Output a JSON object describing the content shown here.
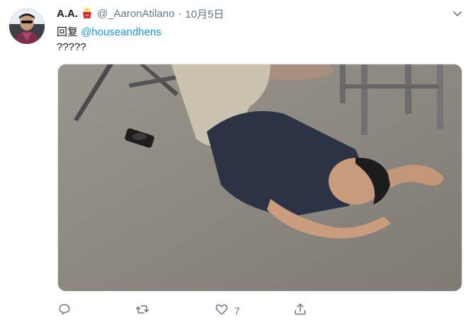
{
  "tweet": {
    "display_name": "A.A.",
    "badge_icon": "fries-emoji-icon",
    "handle": "@_AaronAtilano",
    "separator": "·",
    "timestamp": "10月5日",
    "reply_prefix": "回复",
    "reply_mention": "@houseandhens",
    "text": "?????",
    "media": {
      "kind": "video-still",
      "scene": "man-lying-on-carpet-floor"
    },
    "actions": {
      "reply": {
        "icon": "reply-icon",
        "count": ""
      },
      "retweet": {
        "icon": "retweet-icon",
        "count": ""
      },
      "like": {
        "icon": "heart-icon",
        "count": "7"
      },
      "share": {
        "icon": "share-icon",
        "count": ""
      }
    },
    "colors": {
      "link": "#1b95e0",
      "secondary_text": "#657786",
      "primary_text": "#14171a",
      "border": "#e1e8ed"
    }
  }
}
